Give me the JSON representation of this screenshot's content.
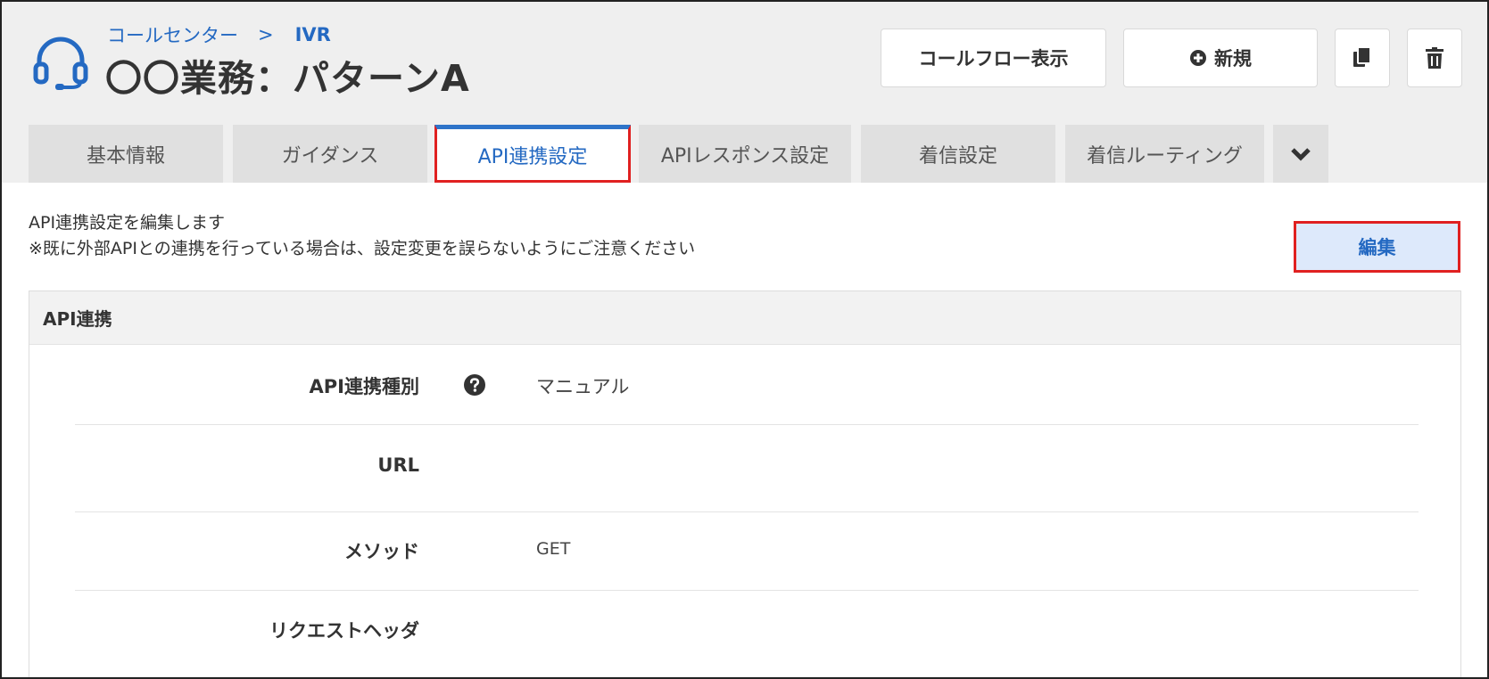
{
  "header": {
    "breadcrumb": [
      "コールセンター",
      ">",
      "IVR"
    ],
    "title": "〇〇業務：パターンA",
    "buttons": {
      "call_flow": "コールフロー表示",
      "new": "新規"
    },
    "icons": [
      "headset-icon",
      "plus-circle-icon",
      "copy-icon",
      "trash-icon"
    ]
  },
  "tabs": [
    {
      "label": "基本情報",
      "active": false
    },
    {
      "label": "ガイダンス",
      "active": false
    },
    {
      "label": "API連携設定",
      "active": true
    },
    {
      "label": "APIレスポンス設定",
      "active": false
    },
    {
      "label": "着信設定",
      "active": false
    },
    {
      "label": "着信ルーティング",
      "active": false
    }
  ],
  "description": {
    "line1": "API連携設定を編集します",
    "line2": "※既に外部APIとの連携を行っている場合は、設定変更を誤らないようにご注意ください"
  },
  "edit_button": "編集",
  "panel": {
    "title": "API連携",
    "rows": [
      {
        "label": "API連携種別",
        "value": "マニュアル",
        "help": true
      },
      {
        "label": "URL",
        "value": ""
      },
      {
        "label": "メソッド",
        "value": "GET"
      },
      {
        "label": "リクエストヘッダ",
        "value": ""
      }
    ]
  },
  "colors": {
    "accent": "#2469c2",
    "highlight": "#e02020",
    "header_bg": "#efefef",
    "tab_bg": "#e0e0e0"
  }
}
